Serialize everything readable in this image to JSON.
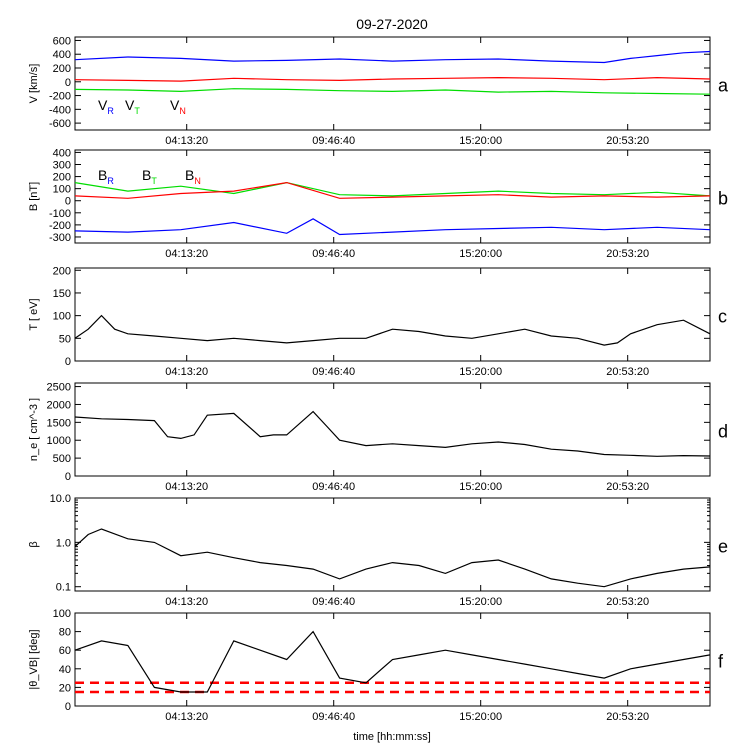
{
  "title": "09-27-2020",
  "xlabel": "time [hh:mm:ss]",
  "x_ticks": [
    "04:13:20",
    "09:46:40",
    "15:20:00",
    "20:53:20"
  ],
  "chart_data": [
    {
      "type": "line",
      "panel": "a",
      "ylabel": "V [km/s]",
      "ylim": [
        -700,
        650
      ],
      "yticks": [
        600,
        400,
        200,
        0,
        -200,
        -400,
        -600
      ],
      "x_range_hours": [
        0,
        24
      ],
      "series": [
        {
          "name": "V_R",
          "color": "#0000ff",
          "x": [
            0,
            2,
            4,
            6,
            8,
            10,
            12,
            14,
            16,
            18,
            20,
            21,
            22,
            23,
            24
          ],
          "y": [
            320,
            360,
            340,
            300,
            310,
            330,
            300,
            320,
            330,
            300,
            280,
            340,
            380,
            420,
            440
          ]
        },
        {
          "name": "V_T",
          "color": "#00dd00",
          "x": [
            0,
            2,
            4,
            6,
            8,
            10,
            12,
            14,
            16,
            18,
            20,
            22,
            24
          ],
          "y": [
            -110,
            -120,
            -140,
            -100,
            -110,
            -130,
            -140,
            -120,
            -150,
            -140,
            -160,
            -170,
            -180
          ]
        },
        {
          "name": "V_N",
          "color": "#ff0000",
          "x": [
            0,
            2,
            4,
            6,
            8,
            10,
            12,
            14,
            16,
            18,
            20,
            22,
            24
          ],
          "y": [
            30,
            20,
            10,
            50,
            30,
            20,
            40,
            50,
            60,
            50,
            30,
            60,
            40
          ]
        }
      ],
      "legend": [
        {
          "main": "V",
          "sub": "R",
          "color": "#0000ff"
        },
        {
          "main": "V",
          "sub": "T",
          "color": "#00dd00"
        },
        {
          "main": "V",
          "sub": "N",
          "color": "#ff0000"
        }
      ]
    },
    {
      "type": "line",
      "panel": "b",
      "ylabel": "B [nT]",
      "ylim": [
        -350,
        420
      ],
      "yticks": [
        400,
        300,
        200,
        100,
        0,
        -100,
        -200,
        -300
      ],
      "x_range_hours": [
        0,
        24
      ],
      "series": [
        {
          "name": "B_R",
          "color": "#0000ff",
          "x": [
            0,
            2,
            4,
            6,
            8,
            9,
            10,
            12,
            14,
            16,
            18,
            20,
            22,
            24
          ],
          "y": [
            -250,
            -260,
            -240,
            -180,
            -270,
            -150,
            -280,
            -260,
            -240,
            -230,
            -220,
            -240,
            -220,
            -240
          ]
        },
        {
          "name": "B_T",
          "color": "#00dd00",
          "x": [
            0,
            2,
            4,
            6,
            8,
            10,
            12,
            14,
            16,
            18,
            20,
            22,
            24
          ],
          "y": [
            150,
            80,
            120,
            60,
            150,
            50,
            40,
            60,
            80,
            60,
            50,
            70,
            40
          ]
        },
        {
          "name": "B_N",
          "color": "#ff0000",
          "x": [
            0,
            2,
            4,
            6,
            8,
            10,
            12,
            14,
            16,
            18,
            20,
            22,
            24
          ],
          "y": [
            40,
            20,
            60,
            80,
            150,
            20,
            30,
            40,
            50,
            30,
            40,
            30,
            40
          ]
        }
      ],
      "legend": [
        {
          "main": "B",
          "sub": "R",
          "color": "#0000ff"
        },
        {
          "main": "B",
          "sub": "T",
          "color": "#00dd00"
        },
        {
          "main": "B",
          "sub": "N",
          "color": "#ff0000"
        }
      ]
    },
    {
      "type": "line",
      "panel": "c",
      "ylabel": "T [ eV]",
      "ylim": [
        0,
        205
      ],
      "yticks": [
        200,
        150,
        100,
        50,
        0
      ],
      "x_range_hours": [
        0,
        24
      ],
      "series": [
        {
          "name": "",
          "color": "#000000",
          "x": [
            0,
            0.5,
            1,
            1.5,
            2,
            3,
            4,
            5,
            6,
            7,
            8,
            9,
            10,
            11,
            12,
            13,
            14,
            15,
            16,
            17,
            18,
            19,
            20,
            20.5,
            21,
            22,
            23,
            24
          ],
          "y": [
            50,
            70,
            100,
            70,
            60,
            55,
            50,
            45,
            50,
            45,
            40,
            45,
            50,
            50,
            70,
            65,
            55,
            50,
            60,
            70,
            55,
            50,
            35,
            40,
            60,
            80,
            90,
            60
          ]
        }
      ]
    },
    {
      "type": "line",
      "panel": "d",
      "ylabel": "n_e [ cm^-3 ]",
      "ylim": [
        0,
        2600
      ],
      "yticks": [
        2500,
        2000,
        1500,
        1000,
        500,
        0
      ],
      "x_range_hours": [
        0,
        24
      ],
      "series": [
        {
          "name": "",
          "color": "#000000",
          "x": [
            0,
            1,
            2,
            3,
            3.5,
            4,
            4.5,
            5,
            6,
            7,
            7.5,
            8,
            9,
            9.5,
            10,
            11,
            12,
            13,
            14,
            15,
            16,
            17,
            18,
            19,
            20,
            21,
            22,
            23,
            24
          ],
          "y": [
            1650,
            1600,
            1580,
            1550,
            1100,
            1050,
            1150,
            1700,
            1750,
            1100,
            1150,
            1150,
            1800,
            1400,
            1000,
            850,
            900,
            850,
            800,
            900,
            950,
            880,
            750,
            700,
            600,
            580,
            550,
            570,
            560
          ]
        }
      ]
    },
    {
      "type": "line",
      "panel": "e",
      "ylabel": "β",
      "yscale": "log",
      "ylim": [
        0.08,
        10
      ],
      "yticks": [
        10.0,
        1.0,
        0.1
      ],
      "ytick_labels": [
        "10.0",
        "1.0",
        "0.1"
      ],
      "x_range_hours": [
        0,
        24
      ],
      "series": [
        {
          "name": "",
          "color": "#000000",
          "x": [
            0,
            0.5,
            1,
            2,
            3,
            4,
            5,
            6,
            7,
            8,
            9,
            10,
            11,
            12,
            13,
            14,
            15,
            16,
            17,
            18,
            19,
            20,
            21,
            22,
            23,
            24
          ],
          "y": [
            0.8,
            1.5,
            2.0,
            1.2,
            1.0,
            0.5,
            0.6,
            0.45,
            0.35,
            0.3,
            0.25,
            0.15,
            0.25,
            0.35,
            0.3,
            0.2,
            0.35,
            0.4,
            0.25,
            0.15,
            0.12,
            0.1,
            0.15,
            0.2,
            0.25,
            0.28
          ]
        }
      ]
    },
    {
      "type": "line",
      "panel": "f",
      "ylabel": "|θ_VB| [deg]",
      "ylim": [
        0,
        100
      ],
      "yticks": [
        100,
        80,
        60,
        40,
        20,
        0
      ],
      "x_range_hours": [
        0,
        24
      ],
      "series": [
        {
          "name": "",
          "color": "#000000",
          "x": [
            0,
            1,
            2,
            3,
            4,
            5,
            6,
            7,
            8,
            9,
            10,
            11,
            12,
            13,
            14,
            15,
            16,
            17,
            18,
            19,
            20,
            21,
            22,
            23,
            24
          ],
          "y": [
            60,
            70,
            65,
            20,
            15,
            15,
            70,
            60,
            50,
            80,
            30,
            25,
            50,
            55,
            60,
            55,
            50,
            45,
            40,
            35,
            30,
            40,
            45,
            50,
            55
          ]
        }
      ],
      "thresholds": [
        {
          "y": 15,
          "color": "#ff0000",
          "style": "dashed"
        },
        {
          "y": 25,
          "color": "#ff0000",
          "style": "dashed"
        }
      ]
    }
  ]
}
